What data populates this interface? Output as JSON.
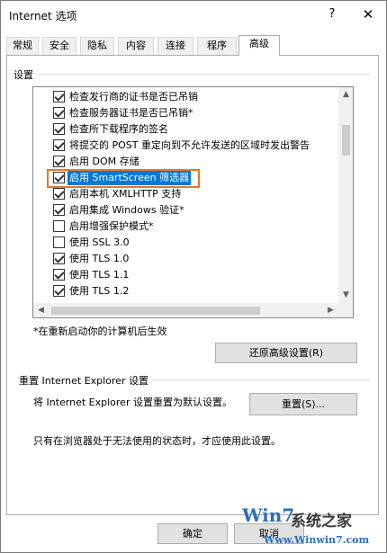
{
  "window": {
    "title": "Internet 选项",
    "help_label": "?",
    "close_label": "✕"
  },
  "tabs": [
    {
      "label": "常规"
    },
    {
      "label": "安全"
    },
    {
      "label": "隐私"
    },
    {
      "label": "内容"
    },
    {
      "label": "连接"
    },
    {
      "label": "程序"
    },
    {
      "label": "高级",
      "active": true
    }
  ],
  "settings": {
    "group_label": "设置",
    "items": [
      {
        "label": "检查发行商的证书是否已吊销",
        "checked": true
      },
      {
        "label": "检查服务器证书是否已吊销*",
        "checked": true
      },
      {
        "label": "检查所下载程序的签名",
        "checked": true
      },
      {
        "label": "将提交的 POST 重定向到不允许发送的区域时发出警告",
        "checked": true
      },
      {
        "label": "启用 DOM 存储",
        "checked": true
      },
      {
        "label": "启用 SmartScreen 筛选器",
        "checked": true,
        "selected": true
      },
      {
        "label": "启用本机 XMLHTTP 支持",
        "checked": true
      },
      {
        "label": "启用集成 Windows 验证*",
        "checked": true
      },
      {
        "label": "启用增强保护模式*",
        "checked": false
      },
      {
        "label": "使用 SSL 3.0",
        "checked": false
      },
      {
        "label": "使用 TLS 1.0",
        "checked": true
      },
      {
        "label": "使用 TLS 1.1",
        "checked": true
      },
      {
        "label": "使用 TLS 1.2",
        "checked": true
      }
    ],
    "restart_note": "*在重新启动你的计算机后生效",
    "restore_button": "还原高级设置(R)"
  },
  "reset": {
    "section_label": "重置 Internet Explorer 设置",
    "description": "将 Internet Explorer 设置重置为默认设置。",
    "button": "重置(S)...",
    "note": "只有在浏览器处于无法使用的状态时，才应使用此设置。"
  },
  "footer": {
    "ok": "确定",
    "cancel": "取消"
  },
  "watermark": {
    "logo": "Win7",
    "text": "系统之家",
    "url": "Www.Winwin7.com"
  },
  "colors": {
    "selection": "#0078d7",
    "highlight_border": "#e87722"
  }
}
